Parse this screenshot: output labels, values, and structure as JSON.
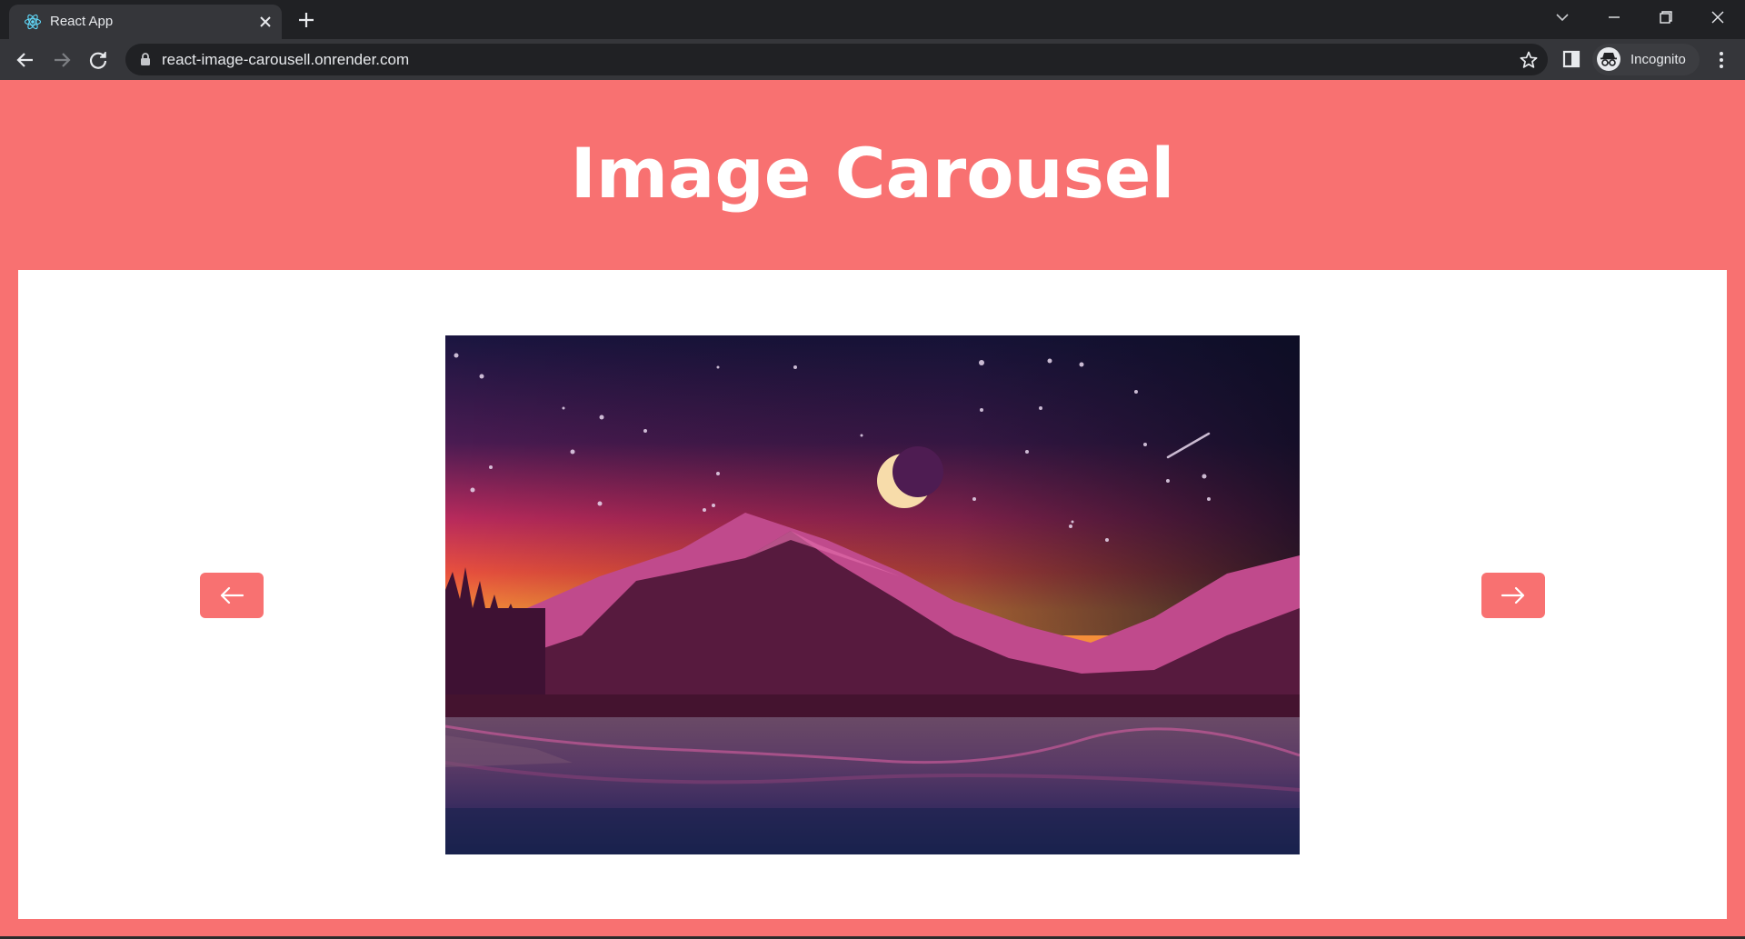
{
  "browser": {
    "tab_title": "React App",
    "url": "react-image-carousell.onrender.com",
    "profile_label": "Incognito"
  },
  "page": {
    "title": "Image Carousel"
  },
  "carousel": {
    "prev_icon": "arrow-left-icon",
    "next_icon": "arrow-right-icon",
    "slide_image": "night-mountain-lake-landscape"
  },
  "colors": {
    "page_background": "#f87171",
    "panel_background": "#ffffff",
    "button_background": "#f87171"
  }
}
